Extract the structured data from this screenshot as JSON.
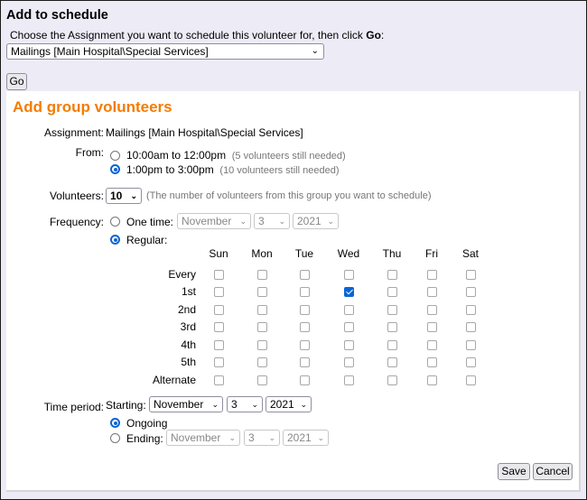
{
  "header": {
    "title": "Add to schedule",
    "instruction_prefix": "Choose the Assignment you want to schedule this volunteer for, then click ",
    "instruction_bold": "Go",
    "instruction_suffix": ":",
    "assignment_select_value": "Mailings [Main Hospital\\Special Services]",
    "go_label": "Go"
  },
  "panel": {
    "title": "Add group volunteers",
    "assignment_label": "Assignment:",
    "assignment_value": "Mailings [Main Hospital\\Special Services]",
    "from_label": "From:",
    "from_options": [
      {
        "label": "10:00am to 12:00pm",
        "hint": "(5 volunteers still needed)",
        "selected": false
      },
      {
        "label": "1:00pm to 3:00pm",
        "hint": "(10 volunteers still needed)",
        "selected": true
      }
    ],
    "volunteers_label": "Volunteers:",
    "volunteers_value": "10",
    "volunteers_hint": "(The number of volunteers from this group you want to schedule)",
    "frequency_label": "Frequency:",
    "one_time_label": "One time:",
    "one_time_month": "November",
    "one_time_day": "3",
    "one_time_year": "2021",
    "regular_label": "Regular:",
    "frequency_selected": "regular",
    "days": [
      "Sun",
      "Mon",
      "Tue",
      "Wed",
      "Thu",
      "Fri",
      "Sat"
    ],
    "rows": [
      "Every",
      "1st",
      "2nd",
      "3rd",
      "4th",
      "5th",
      "Alternate"
    ],
    "checked": [
      {
        "row": "1st",
        "day": "Wed"
      }
    ],
    "time_period_label": "Time period:",
    "starting_label": "Starting:",
    "start_month": "November",
    "start_day": "3",
    "start_year": "2021",
    "ongoing_label": "Ongoing",
    "ending_label": "Ending:",
    "end_month": "November",
    "end_day": "3",
    "end_year": "2021",
    "period_selected": "ongoing",
    "save_label": "Save",
    "cancel_label": "Cancel"
  },
  "colors": {
    "accent_title": "#f47c00",
    "check_blue": "#0a64d6",
    "background": "#edebf6"
  }
}
